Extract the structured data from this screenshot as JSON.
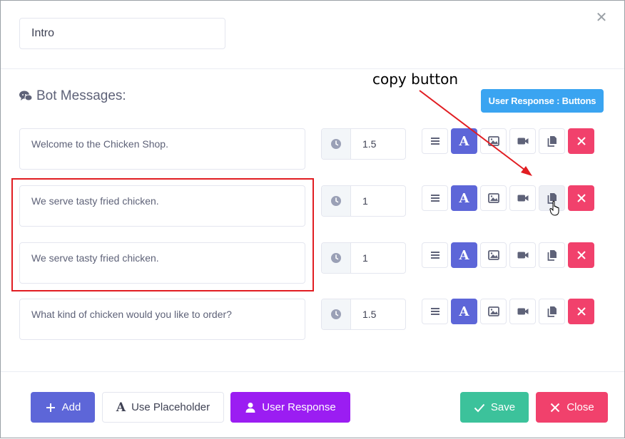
{
  "intent": {
    "title_value": "Intro"
  },
  "section": {
    "title": "Bot Messages:",
    "user_response_label": "User Response : Buttons"
  },
  "messages": [
    {
      "text": "Welcome to the Chicken Shop.",
      "delay": "1.5"
    },
    {
      "text": "We serve tasty fried chicken.",
      "delay": "1"
    },
    {
      "text": "We serve tasty fried chicken.",
      "delay": "1"
    },
    {
      "text": "What kind of chicken would you like to order?",
      "delay": "1.5"
    }
  ],
  "tools": {
    "font_glyph": "A"
  },
  "annotation": {
    "label": "copy button"
  },
  "footer": {
    "add_label": "Add",
    "placeholder_label": "Use Placeholder",
    "user_response_label": "User Response",
    "save_label": "Save",
    "close_label": "Close"
  },
  "colors": {
    "primary": "#5d66d8",
    "danger": "#f1416c",
    "success": "#3cc29b",
    "purple": "#9b1df2",
    "info": "#3aa4f1",
    "annotation": "#e11d22"
  }
}
